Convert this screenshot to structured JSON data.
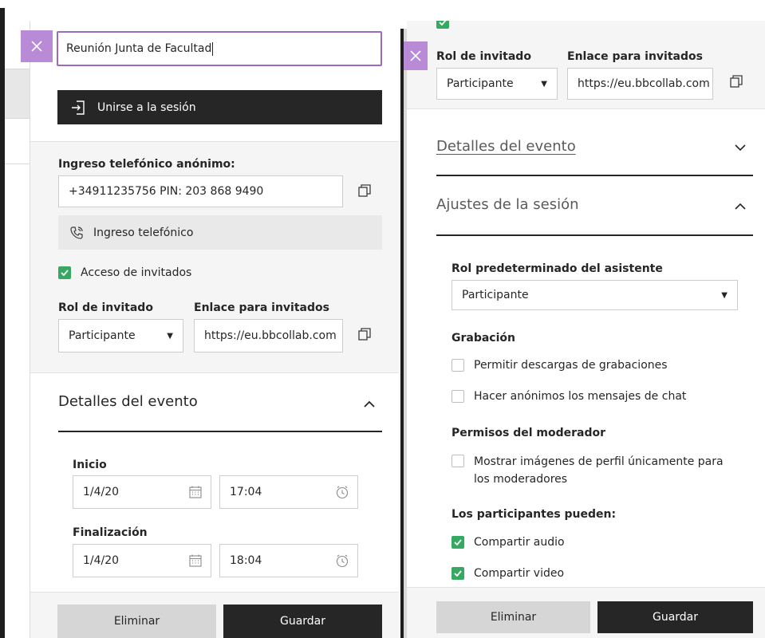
{
  "left": {
    "title_value": "Reunión Junta de Facultad",
    "join_label": "Unirse a la sesión",
    "phone_heading": "Ingreso telefónico anónimo:",
    "phone_value": "+34911235756 PIN: 203 868 9490",
    "phone_button": "Ingreso telefónico",
    "guest_access_label": "Acceso de invitados",
    "guest_access_checked": true,
    "guest_role_heading": "Rol de invitado",
    "guest_role_value": "Participante",
    "guest_link_heading": "Enlace para invitados",
    "guest_link_value": "https://eu.bbcollab.com",
    "event_details_title": "Detalles del evento",
    "start_label": "Inicio",
    "start_date": "1/4/20",
    "start_time": "17:04",
    "end_label": "Finalización",
    "end_date": "1/4/20",
    "end_time": "18:04",
    "delete_label": "Eliminar",
    "save_label": "Guardar"
  },
  "right": {
    "guest_role_heading": "Rol de invitado",
    "guest_role_value": "Participante",
    "guest_link_heading": "Enlace para invitados",
    "guest_link_value": "https://eu.bbcollab.com",
    "event_details_title": "Detalles del evento",
    "session_settings_title": "Ajustes de la sesión",
    "default_role_heading": "Rol predeterminado del asistente",
    "default_role_value": "Participante",
    "recording_heading": "Grabación",
    "allow_downloads_label": "Permitir descargas de grabaciones",
    "anonymize_chat_label": "Hacer anónimos los mensajes de chat",
    "moderator_heading": "Permisos del moderador",
    "profile_images_label_1": "Mostrar imágenes de perfil únicamente para",
    "profile_images_label_2": "los moderadores",
    "participants_heading": "Los participantes pueden:",
    "share_audio_label": "Compartir audio",
    "share_video_label": "Compartir video",
    "delete_label": "Eliminar",
    "save_label": "Guardar"
  },
  "colors": {
    "accent_purple": "#b98bd6",
    "check_green": "#37a862",
    "dark": "#262626"
  }
}
